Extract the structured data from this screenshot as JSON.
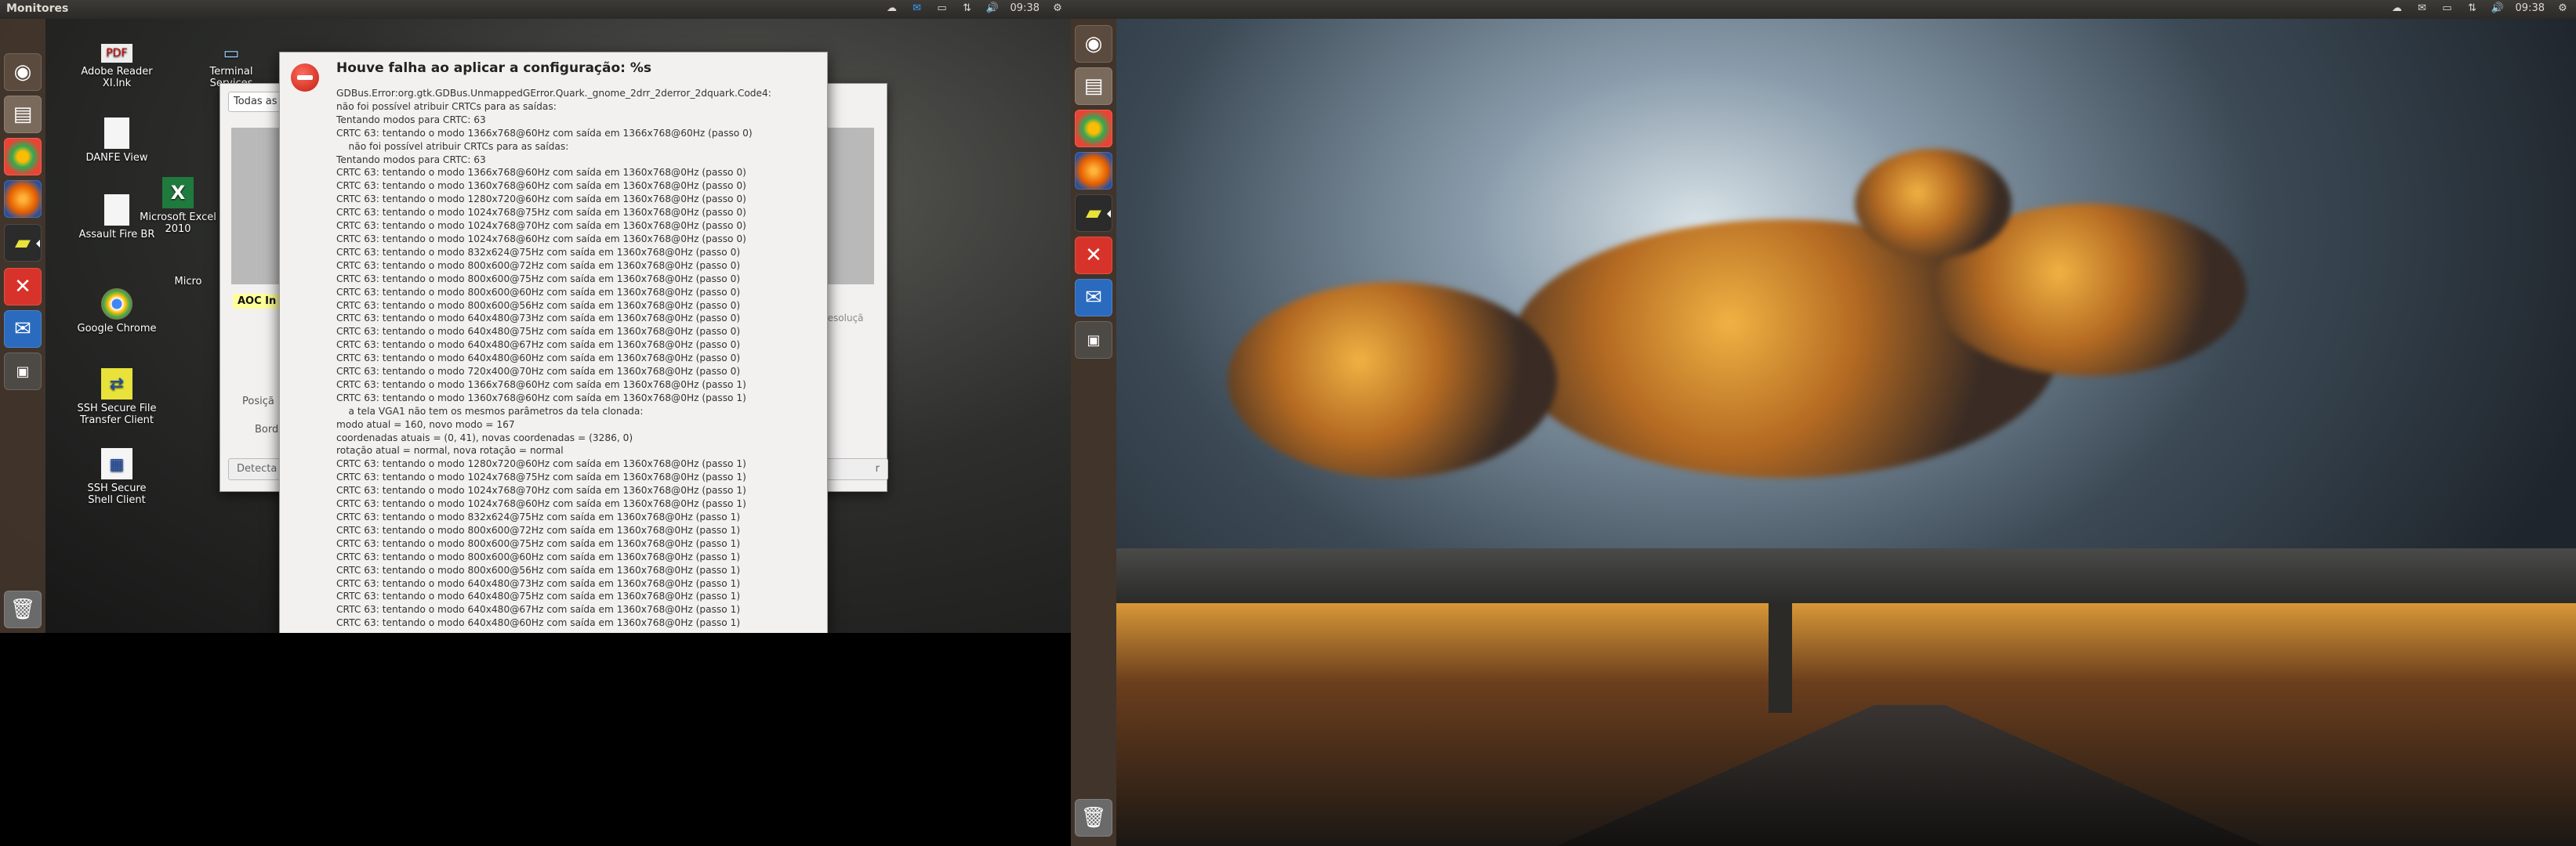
{
  "left_panel": {
    "title": "Monitores",
    "clock": "09:38"
  },
  "right_panel": {
    "clock": "09:38"
  },
  "desktop_icons": [
    {
      "label": "Adobe Reader XI.lnk",
      "icon": "pdf-file-icon"
    },
    {
      "label": "Terminal Services",
      "icon": "terminal-icon"
    },
    {
      "label": "DANFE View",
      "icon": "document-icon"
    },
    {
      "label": "Assault Fire BR",
      "icon": "document-icon"
    },
    {
      "label": "Microsoft Excel 2010",
      "icon": "excel-icon"
    },
    {
      "label": "Micro",
      "icon": "app-icon"
    },
    {
      "label": "Google Chrome",
      "icon": "chrome-icon"
    },
    {
      "label": "SSH Secure File Transfer Client",
      "icon": "ssh-ftp-icon"
    },
    {
      "label": "SSH Secure Shell Client",
      "icon": "ssh-shell-icon"
    }
  ],
  "displays_dialog": {
    "combo_value": "Todas as",
    "monitor_label": "AOC In",
    "position_label": "Posiçã",
    "border_label": "Bord",
    "resolution_label": "resoluçã",
    "detect_button": "Detecta",
    "apply_button": "r"
  },
  "error_dialog": {
    "title": "Houve falha ao aplicar a configuração: %s",
    "lines": [
      "GDBus.Error:org.gtk.GDBus.UnmappedGError.Quark._gnome_2drr_2derror_2dquark.Code4:",
      "não foi possível atribuir CRTCs para as saídas:",
      "Tentando modos para CRTC: 63",
      "CRTC 63: tentando o modo 1366x768@60Hz com saída em 1366x768@60Hz (passo 0)",
      "    não foi possível atribuir CRTCs para as saídas:",
      "Tentando modos para CRTC: 63",
      "CRTC 63: tentando o modo 1366x768@60Hz com saída em 1360x768@0Hz (passo 0)",
      "CRTC 63: tentando o modo 1360x768@60Hz com saída em 1360x768@0Hz (passo 0)",
      "CRTC 63: tentando o modo 1280x720@60Hz com saída em 1360x768@0Hz (passo 0)",
      "CRTC 63: tentando o modo 1024x768@75Hz com saída em 1360x768@0Hz (passo 0)",
      "CRTC 63: tentando o modo 1024x768@70Hz com saída em 1360x768@0Hz (passo 0)",
      "CRTC 63: tentando o modo 1024x768@60Hz com saída em 1360x768@0Hz (passo 0)",
      "CRTC 63: tentando o modo 832x624@75Hz com saída em 1360x768@0Hz (passo 0)",
      "CRTC 63: tentando o modo 800x600@72Hz com saída em 1360x768@0Hz (passo 0)",
      "CRTC 63: tentando o modo 800x600@75Hz com saída em 1360x768@0Hz (passo 0)",
      "CRTC 63: tentando o modo 800x600@60Hz com saída em 1360x768@0Hz (passo 0)",
      "CRTC 63: tentando o modo 800x600@56Hz com saída em 1360x768@0Hz (passo 0)",
      "CRTC 63: tentando o modo 640x480@73Hz com saída em 1360x768@0Hz (passo 0)",
      "CRTC 63: tentando o modo 640x480@75Hz com saída em 1360x768@0Hz (passo 0)",
      "CRTC 63: tentando o modo 640x480@67Hz com saída em 1360x768@0Hz (passo 0)",
      "CRTC 63: tentando o modo 640x480@60Hz com saída em 1360x768@0Hz (passo 0)",
      "CRTC 63: tentando o modo 720x400@70Hz com saída em 1360x768@0Hz (passo 0)",
      "CRTC 63: tentando o modo 1366x768@60Hz com saída em 1360x768@0Hz (passo 1)",
      "CRTC 63: tentando o modo 1360x768@60Hz com saída em 1360x768@0Hz (passo 1)",
      "    a tela VGA1 não tem os mesmos parâmetros da tela clonada:",
      "modo atual = 160, novo modo = 167",
      "coordenadas atuais = (0, 41), novas coordenadas = (3286, 0)",
      "rotação atual = normal, nova rotação = normal",
      "CRTC 63: tentando o modo 1280x720@60Hz com saída em 1360x768@0Hz (passo 1)",
      "CRTC 63: tentando o modo 1024x768@75Hz com saída em 1360x768@0Hz (passo 1)",
      "CRTC 63: tentando o modo 1024x768@70Hz com saída em 1360x768@0Hz (passo 1)",
      "CRTC 63: tentando o modo 1024x768@60Hz com saída em 1360x768@0Hz (passo 1)",
      "CRTC 63: tentando o modo 832x624@75Hz com saída em 1360x768@0Hz (passo 1)",
      "CRTC 63: tentando o modo 800x600@72Hz com saída em 1360x768@0Hz (passo 1)",
      "CRTC 63: tentando o modo 800x600@75Hz com saída em 1360x768@0Hz (passo 1)",
      "CRTC 63: tentando o modo 800x600@60Hz com saída em 1360x768@0Hz (passo 1)",
      "CRTC 63: tentando o modo 800x600@56Hz com saída em 1360x768@0Hz (passo 1)",
      "CRTC 63: tentando o modo 640x480@73Hz com saída em 1360x768@0Hz (passo 1)",
      "CRTC 63: tentando o modo 640x480@75Hz com saída em 1360x768@0Hz (passo 1)",
      "CRTC 63: tentando o modo 640x480@67Hz com saída em 1360x768@0Hz (passo 1)",
      "CRTC 63: tentando o modo 640x480@60Hz com saída em 1360x768@0Hz (passo 1)"
    ]
  },
  "launcher_icons": [
    "ubuntu-dash-icon",
    "files-icon",
    "chrome-icon",
    "firefox-icon",
    "monitor-settings-icon",
    "red-app-icon",
    "thunderbird-icon",
    "workspace-icon",
    "trash-icon"
  ],
  "colors": {
    "panel_bg": "#3c3b37",
    "launcher_bg": "#46372d",
    "error_red": "#c21e12",
    "dialog_bg": "#f2f1f0"
  }
}
